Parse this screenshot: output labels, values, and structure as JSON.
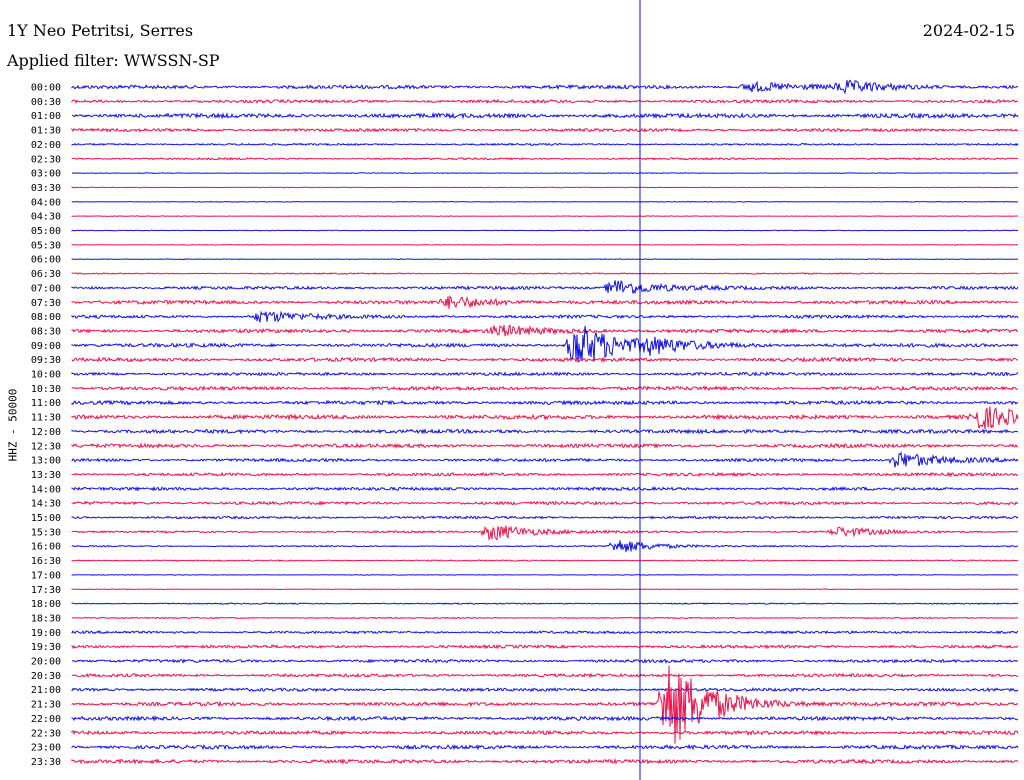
{
  "header": {
    "station": "1Y Neo Petritsi, Serres",
    "date": "2024-02-15",
    "filter": "Applied filter: WWSSN-SP"
  },
  "y_axis_label": "HHZ - 50000",
  "chart_data": {
    "type": "line",
    "title": "1Y Neo Petritsi, Serres",
    "rows": [
      "00:00",
      "00:30",
      "01:00",
      "01:30",
      "02:00",
      "02:30",
      "03:00",
      "03:30",
      "04:00",
      "04:30",
      "05:00",
      "05:30",
      "06:00",
      "06:30",
      "07:00",
      "07:30",
      "08:00",
      "08:30",
      "09:00",
      "09:30",
      "10:00",
      "10:30",
      "11:00",
      "11:30",
      "12:00",
      "12:30",
      "13:00",
      "13:30",
      "14:00",
      "14:30",
      "15:00",
      "15:30",
      "16:00",
      "16:30",
      "17:00",
      "17:30",
      "18:00",
      "18:30",
      "19:00",
      "19:30",
      "20:00",
      "20:30",
      "21:00",
      "21:30",
      "22:00",
      "22:30",
      "23:00",
      "23:30"
    ],
    "row_noise_level": [
      0.6,
      0.5,
      0.7,
      0.5,
      0.3,
      0.3,
      0.1,
      0.1,
      0.1,
      0.1,
      0.1,
      0.1,
      0.1,
      0.2,
      0.5,
      0.6,
      0.5,
      0.6,
      0.6,
      0.6,
      0.5,
      0.6,
      0.6,
      0.7,
      0.6,
      0.6,
      0.5,
      0.5,
      0.5,
      0.5,
      0.4,
      0.3,
      0.2,
      0.2,
      0.1,
      0.1,
      0.2,
      0.2,
      0.4,
      0.5,
      0.5,
      0.5,
      0.5,
      0.6,
      0.6,
      0.6,
      0.6,
      0.6
    ],
    "events": [
      {
        "row": "00:00",
        "minute": 21.5,
        "amplitude": 0.8
      },
      {
        "row": "00:00",
        "minute": 24.5,
        "amplitude": 0.9
      },
      {
        "row": "07:00",
        "minute": 17.2,
        "amplitude": 1.5
      },
      {
        "row": "07:30",
        "minute": 12.0,
        "amplitude": 1.0
      },
      {
        "row": "08:00",
        "minute": 6.0,
        "amplitude": 1.0
      },
      {
        "row": "08:30",
        "minute": 13.5,
        "amplitude": 0.9
      },
      {
        "row": "09:00",
        "minute": 16.0,
        "amplitude": 4.0
      },
      {
        "row": "09:00",
        "minute": 18.3,
        "amplitude": 1.0
      },
      {
        "row": "11:30",
        "minute": 28.8,
        "amplitude": 2.0
      },
      {
        "row": "13:00",
        "minute": 26.2,
        "amplitude": 1.5
      },
      {
        "row": "15:30",
        "minute": 13.3,
        "amplitude": 1.5
      },
      {
        "row": "16:00",
        "minute": 17.3,
        "amplitude": 1.2
      },
      {
        "row": "15:30",
        "minute": 24.3,
        "amplitude": 0.8
      },
      {
        "row": "21:30",
        "minute": 18.9,
        "amplitude": 8.0
      }
    ],
    "colors": {
      "even_rows": "#1010e8",
      "odd_rows": "#f0104a",
      "marker": "#1010e8",
      "text": "#000000"
    }
  }
}
